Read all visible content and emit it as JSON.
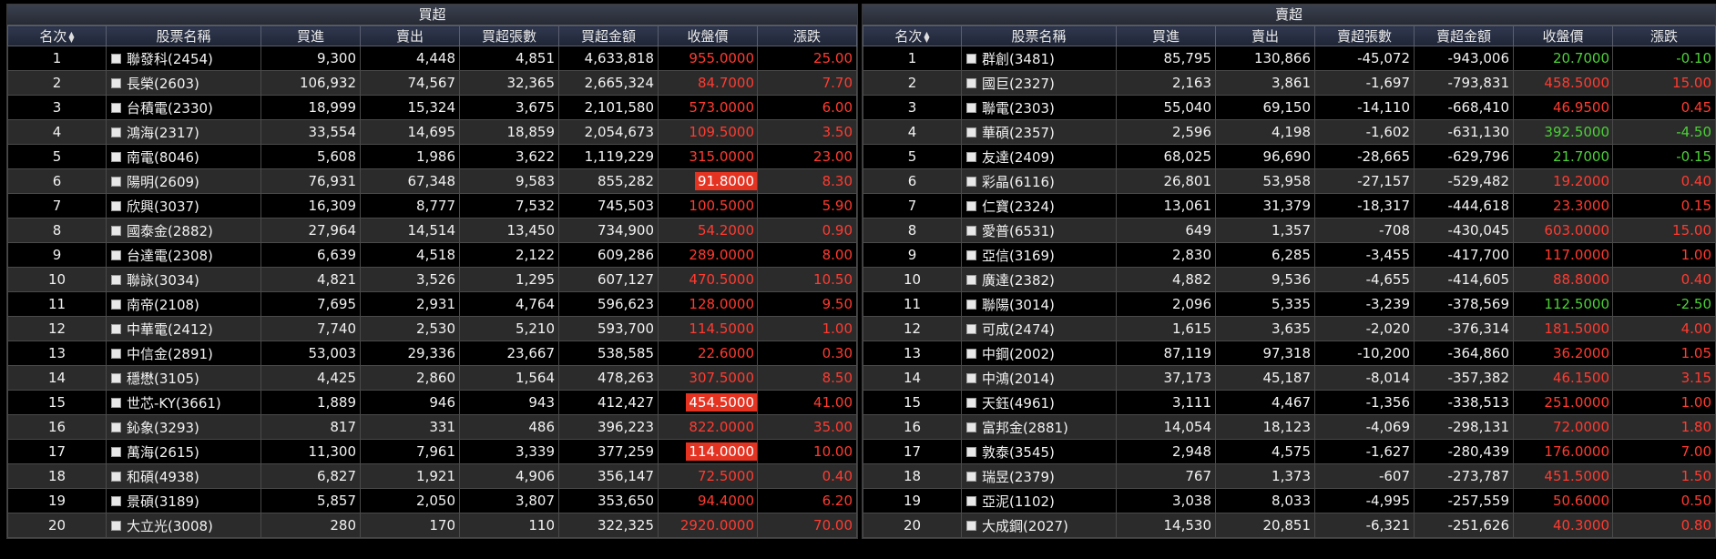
{
  "buy_panel": {
    "title": "買超",
    "headers": [
      "名次",
      "股票名稱",
      "買進",
      "賣出",
      "買超張數",
      "買超金額",
      "收盤價",
      "漲跌"
    ],
    "rows": [
      {
        "rank": "1",
        "name": "聯發科(2454)",
        "buy": "9,300",
        "sell": "4,448",
        "net_vol": "4,851",
        "net_amt": "4,633,818",
        "close": "955.0000",
        "change": "25.00",
        "dir": "up",
        "hl": false
      },
      {
        "rank": "2",
        "name": "長榮(2603)",
        "buy": "106,932",
        "sell": "74,567",
        "net_vol": "32,365",
        "net_amt": "2,665,324",
        "close": "84.7000",
        "change": "7.70",
        "dir": "up",
        "hl": false
      },
      {
        "rank": "3",
        "name": "台積電(2330)",
        "buy": "18,999",
        "sell": "15,324",
        "net_vol": "3,675",
        "net_amt": "2,101,580",
        "close": "573.0000",
        "change": "6.00",
        "dir": "up",
        "hl": false
      },
      {
        "rank": "4",
        "name": "鴻海(2317)",
        "buy": "33,554",
        "sell": "14,695",
        "net_vol": "18,859",
        "net_amt": "2,054,673",
        "close": "109.5000",
        "change": "3.50",
        "dir": "up",
        "hl": false
      },
      {
        "rank": "5",
        "name": "南電(8046)",
        "buy": "5,608",
        "sell": "1,986",
        "net_vol": "3,622",
        "net_amt": "1,119,229",
        "close": "315.0000",
        "change": "23.00",
        "dir": "up",
        "hl": false
      },
      {
        "rank": "6",
        "name": "陽明(2609)",
        "buy": "76,931",
        "sell": "67,348",
        "net_vol": "9,583",
        "net_amt": "855,282",
        "close": "91.8000",
        "change": "8.30",
        "dir": "up",
        "hl": true
      },
      {
        "rank": "7",
        "name": "欣興(3037)",
        "buy": "16,309",
        "sell": "8,777",
        "net_vol": "7,532",
        "net_amt": "745,503",
        "close": "100.5000",
        "change": "5.90",
        "dir": "up",
        "hl": false
      },
      {
        "rank": "8",
        "name": "國泰金(2882)",
        "buy": "27,964",
        "sell": "14,514",
        "net_vol": "13,450",
        "net_amt": "734,900",
        "close": "54.2000",
        "change": "0.90",
        "dir": "up",
        "hl": false
      },
      {
        "rank": "9",
        "name": "台達電(2308)",
        "buy": "6,639",
        "sell": "4,518",
        "net_vol": "2,122",
        "net_amt": "609,286",
        "close": "289.0000",
        "change": "8.00",
        "dir": "up",
        "hl": false
      },
      {
        "rank": "10",
        "name": "聯詠(3034)",
        "buy": "4,821",
        "sell": "3,526",
        "net_vol": "1,295",
        "net_amt": "607,127",
        "close": "470.5000",
        "change": "10.50",
        "dir": "up",
        "hl": false
      },
      {
        "rank": "11",
        "name": "南帝(2108)",
        "buy": "7,695",
        "sell": "2,931",
        "net_vol": "4,764",
        "net_amt": "596,623",
        "close": "128.0000",
        "change": "9.50",
        "dir": "up",
        "hl": false
      },
      {
        "rank": "12",
        "name": "中華電(2412)",
        "buy": "7,740",
        "sell": "2,530",
        "net_vol": "5,210",
        "net_amt": "593,700",
        "close": "114.5000",
        "change": "1.00",
        "dir": "up",
        "hl": false
      },
      {
        "rank": "13",
        "name": "中信金(2891)",
        "buy": "53,003",
        "sell": "29,336",
        "net_vol": "23,667",
        "net_amt": "538,585",
        "close": "22.6000",
        "change": "0.30",
        "dir": "up",
        "hl": false
      },
      {
        "rank": "14",
        "name": "穩懋(3105)",
        "buy": "4,425",
        "sell": "2,860",
        "net_vol": "1,564",
        "net_amt": "478,263",
        "close": "307.5000",
        "change": "8.50",
        "dir": "up",
        "hl": false
      },
      {
        "rank": "15",
        "name": "世芯-KY(3661)",
        "buy": "1,889",
        "sell": "946",
        "net_vol": "943",
        "net_amt": "412,427",
        "close": "454.5000",
        "change": "41.00",
        "dir": "up",
        "hl": true
      },
      {
        "rank": "16",
        "name": "鈊象(3293)",
        "buy": "817",
        "sell": "331",
        "net_vol": "486",
        "net_amt": "396,223",
        "close": "822.0000",
        "change": "35.00",
        "dir": "up",
        "hl": false
      },
      {
        "rank": "17",
        "name": "萬海(2615)",
        "buy": "11,300",
        "sell": "7,961",
        "net_vol": "3,339",
        "net_amt": "377,259",
        "close": "114.0000",
        "change": "10.00",
        "dir": "up",
        "hl": true
      },
      {
        "rank": "18",
        "name": "和碩(4938)",
        "buy": "6,827",
        "sell": "1,921",
        "net_vol": "4,906",
        "net_amt": "356,147",
        "close": "72.5000",
        "change": "0.40",
        "dir": "up",
        "hl": false
      },
      {
        "rank": "19",
        "name": "景碩(3189)",
        "buy": "5,857",
        "sell": "2,050",
        "net_vol": "3,807",
        "net_amt": "353,650",
        "close": "94.4000",
        "change": "6.20",
        "dir": "up",
        "hl": false
      },
      {
        "rank": "20",
        "name": "大立光(3008)",
        "buy": "280",
        "sell": "170",
        "net_vol": "110",
        "net_amt": "322,325",
        "close": "2920.0000",
        "change": "70.00",
        "dir": "up",
        "hl": false
      }
    ]
  },
  "sell_panel": {
    "title": "賣超",
    "headers": [
      "名次",
      "股票名稱",
      "買進",
      "賣出",
      "賣超張數",
      "賣超金額",
      "收盤價",
      "漲跌"
    ],
    "rows": [
      {
        "rank": "1",
        "name": "群創(3481)",
        "buy": "85,795",
        "sell": "130,866",
        "net_vol": "-45,072",
        "net_amt": "-943,006",
        "close": "20.7000",
        "change": "-0.10",
        "dir": "down",
        "hl": false
      },
      {
        "rank": "2",
        "name": "國巨(2327)",
        "buy": "2,163",
        "sell": "3,861",
        "net_vol": "-1,697",
        "net_amt": "-793,831",
        "close": "458.5000",
        "change": "15.00",
        "dir": "up",
        "hl": false
      },
      {
        "rank": "3",
        "name": "聯電(2303)",
        "buy": "55,040",
        "sell": "69,150",
        "net_vol": "-14,110",
        "net_amt": "-668,410",
        "close": "46.9500",
        "change": "0.45",
        "dir": "up",
        "hl": false
      },
      {
        "rank": "4",
        "name": "華碩(2357)",
        "buy": "2,596",
        "sell": "4,198",
        "net_vol": "-1,602",
        "net_amt": "-631,130",
        "close": "392.5000",
        "change": "-4.50",
        "dir": "down",
        "hl": false
      },
      {
        "rank": "5",
        "name": "友達(2409)",
        "buy": "68,025",
        "sell": "96,690",
        "net_vol": "-28,665",
        "net_amt": "-629,796",
        "close": "21.7000",
        "change": "-0.15",
        "dir": "down",
        "hl": false
      },
      {
        "rank": "6",
        "name": "彩晶(6116)",
        "buy": "26,801",
        "sell": "53,958",
        "net_vol": "-27,157",
        "net_amt": "-529,482",
        "close": "19.2000",
        "change": "0.40",
        "dir": "up",
        "hl": false
      },
      {
        "rank": "7",
        "name": "仁寶(2324)",
        "buy": "13,061",
        "sell": "31,379",
        "net_vol": "-18,317",
        "net_amt": "-444,618",
        "close": "23.3000",
        "change": "0.15",
        "dir": "up",
        "hl": false
      },
      {
        "rank": "8",
        "name": "愛普(6531)",
        "buy": "649",
        "sell": "1,357",
        "net_vol": "-708",
        "net_amt": "-430,045",
        "close": "603.0000",
        "change": "15.00",
        "dir": "up",
        "hl": false
      },
      {
        "rank": "9",
        "name": "亞信(3169)",
        "buy": "2,830",
        "sell": "6,285",
        "net_vol": "-3,455",
        "net_amt": "-417,700",
        "close": "117.0000",
        "change": "1.00",
        "dir": "up",
        "hl": false
      },
      {
        "rank": "10",
        "name": "廣達(2382)",
        "buy": "4,882",
        "sell": "9,536",
        "net_vol": "-4,655",
        "net_amt": "-414,605",
        "close": "88.8000",
        "change": "0.40",
        "dir": "up",
        "hl": false
      },
      {
        "rank": "11",
        "name": "聯陽(3014)",
        "buy": "2,096",
        "sell": "5,335",
        "net_vol": "-3,239",
        "net_amt": "-378,569",
        "close": "112.5000",
        "change": "-2.50",
        "dir": "down",
        "hl": false
      },
      {
        "rank": "12",
        "name": "可成(2474)",
        "buy": "1,615",
        "sell": "3,635",
        "net_vol": "-2,020",
        "net_amt": "-376,314",
        "close": "181.5000",
        "change": "4.00",
        "dir": "up",
        "hl": false
      },
      {
        "rank": "13",
        "name": "中鋼(2002)",
        "buy": "87,119",
        "sell": "97,318",
        "net_vol": "-10,200",
        "net_amt": "-364,860",
        "close": "36.2000",
        "change": "1.05",
        "dir": "up",
        "hl": false
      },
      {
        "rank": "14",
        "name": "中鴻(2014)",
        "buy": "37,173",
        "sell": "45,187",
        "net_vol": "-8,014",
        "net_amt": "-357,382",
        "close": "46.1500",
        "change": "3.15",
        "dir": "up",
        "hl": false
      },
      {
        "rank": "15",
        "name": "天鈺(4961)",
        "buy": "3,111",
        "sell": "4,467",
        "net_vol": "-1,356",
        "net_amt": "-338,513",
        "close": "251.0000",
        "change": "1.00",
        "dir": "up",
        "hl": false
      },
      {
        "rank": "16",
        "name": "富邦金(2881)",
        "buy": "14,054",
        "sell": "18,123",
        "net_vol": "-4,069",
        "net_amt": "-298,131",
        "close": "72.0000",
        "change": "1.80",
        "dir": "up",
        "hl": false
      },
      {
        "rank": "17",
        "name": "敦泰(3545)",
        "buy": "2,948",
        "sell": "4,575",
        "net_vol": "-1,627",
        "net_amt": "-280,439",
        "close": "176.0000",
        "change": "7.00",
        "dir": "up",
        "hl": false
      },
      {
        "rank": "18",
        "name": "瑞昱(2379)",
        "buy": "767",
        "sell": "1,373",
        "net_vol": "-607",
        "net_amt": "-273,787",
        "close": "451.5000",
        "change": "1.50",
        "dir": "up",
        "hl": false
      },
      {
        "rank": "19",
        "name": "亞泥(1102)",
        "buy": "3,038",
        "sell": "8,033",
        "net_vol": "-4,995",
        "net_amt": "-257,559",
        "close": "50.6000",
        "change": "0.50",
        "dir": "up",
        "hl": false
      },
      {
        "rank": "20",
        "name": "大成鋼(2027)",
        "buy": "14,530",
        "sell": "20,851",
        "net_vol": "-6,321",
        "net_amt": "-251,626",
        "close": "40.3000",
        "change": "0.80",
        "dir": "up",
        "hl": false
      }
    ]
  },
  "colors": {
    "up": "#ff3b30",
    "down": "#4cd137",
    "highlight_bg": "#e53322",
    "header_bg": "#262d40"
  }
}
